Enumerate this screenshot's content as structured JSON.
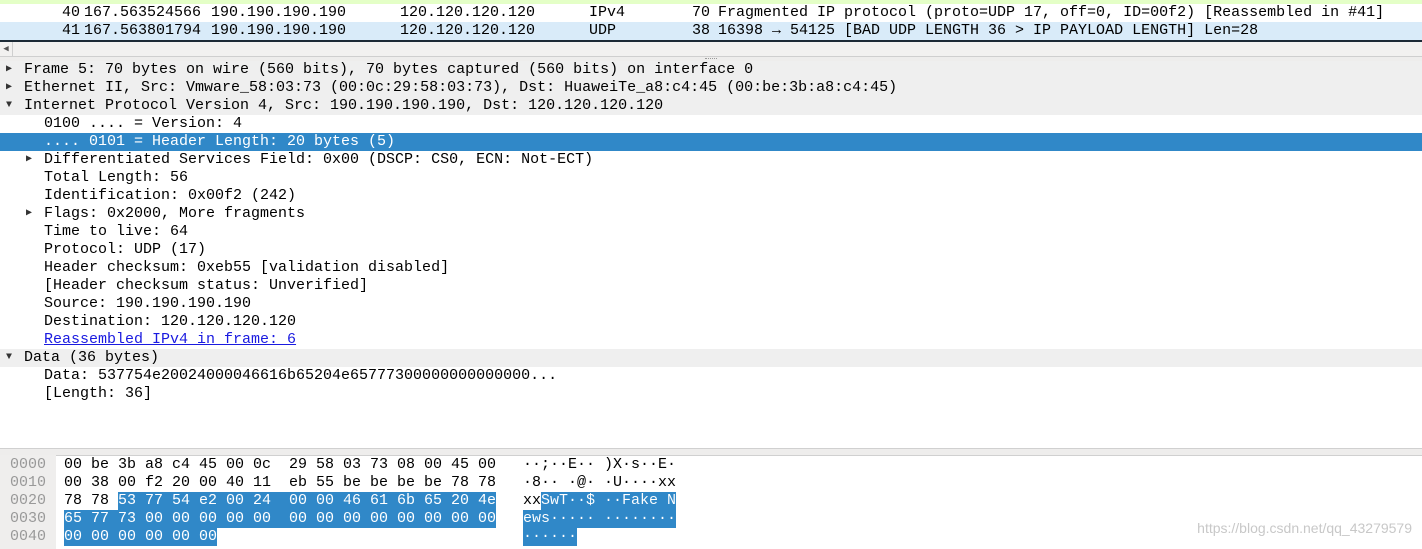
{
  "packet_list": {
    "rows": [
      {
        "no": "40",
        "time": "167.563524566",
        "source": "190.190.190.190",
        "destination": "120.120.120.120",
        "protocol": "IPv4",
        "length": "70",
        "info": "Fragmented IP protocol (proto=UDP 17, off=0, ID=00f2) [Reassembled in #41]"
      },
      {
        "no": "41",
        "time": "167.563801794",
        "source": "190.190.190.190",
        "destination": "120.120.120.120",
        "protocol": "UDP",
        "length": "38",
        "info": "16398 → 54125 [BAD UDP LENGTH 36 > IP PAYLOAD LENGTH] Len=28"
      }
    ],
    "row_colors": {
      "row40": "#ffffff",
      "row41": "#d9ebf9"
    }
  },
  "tree": {
    "rows": [
      {
        "level": 0,
        "expand": "collapsed",
        "text": "Frame 5: 70 bytes on wire (560 bits), 70 bytes captured (560 bits) on interface 0"
      },
      {
        "level": 0,
        "expand": "collapsed",
        "text": "Ethernet II, Src: Vmware_58:03:73 (00:0c:29:58:03:73), Dst: HuaweiTe_a8:c4:45 (00:be:3b:a8:c4:45)"
      },
      {
        "level": 0,
        "expand": "expanded",
        "text": "Internet Protocol Version 4, Src: 190.190.190.190, Dst: 120.120.120.120"
      },
      {
        "level": 1,
        "expand": "none",
        "text": "0100 .... = Version: 4"
      },
      {
        "level": 1,
        "expand": "none",
        "text": ".... 0101 = Header Length: 20 bytes (5)",
        "selected": true
      },
      {
        "level": 1,
        "expand": "collapsed",
        "text": "Differentiated Services Field: 0x00 (DSCP: CS0, ECN: Not-ECT)"
      },
      {
        "level": 1,
        "expand": "none",
        "text": "Total Length: 56"
      },
      {
        "level": 1,
        "expand": "none",
        "text": "Identification: 0x00f2 (242)"
      },
      {
        "level": 1,
        "expand": "collapsed",
        "text": "Flags: 0x2000, More fragments"
      },
      {
        "level": 1,
        "expand": "none",
        "text": "Time to live: 64"
      },
      {
        "level": 1,
        "expand": "none",
        "text": "Protocol: UDP (17)"
      },
      {
        "level": 1,
        "expand": "none",
        "text": "Header checksum: 0xeb55 [validation disabled]"
      },
      {
        "level": 1,
        "expand": "none",
        "text": "[Header checksum status: Unverified]"
      },
      {
        "level": 1,
        "expand": "none",
        "text": "Source: 190.190.190.190"
      },
      {
        "level": 1,
        "expand": "none",
        "text": "Destination: 120.120.120.120"
      },
      {
        "level": 1,
        "expand": "none",
        "text": "Reassembled IPv4 in frame: 6",
        "link": true
      },
      {
        "level": 0,
        "expand": "expanded",
        "text": "Data (36 bytes)"
      },
      {
        "level": 1,
        "expand": "none",
        "text": "Data: 537754e20024000046616b65204e65777300000000000000..."
      },
      {
        "level": 1,
        "expand": "none",
        "text": "[Length: 36]"
      }
    ]
  },
  "hex": {
    "highlight_from_byte": 34,
    "rows": [
      {
        "offset": "0000",
        "bytes": [
          "00",
          "be",
          "3b",
          "a8",
          "c4",
          "45",
          "00",
          "0c",
          "29",
          "58",
          "03",
          "73",
          "08",
          "00",
          "45",
          "00"
        ],
        "ascii": "··;··E·· )X·s··E·"
      },
      {
        "offset": "0010",
        "bytes": [
          "00",
          "38",
          "00",
          "f2",
          "20",
          "00",
          "40",
          "11",
          "eb",
          "55",
          "be",
          "be",
          "be",
          "be",
          "78",
          "78"
        ],
        "ascii": "·8·· ·@· ·U····xx"
      },
      {
        "offset": "0020",
        "bytes": [
          "78",
          "78",
          "53",
          "77",
          "54",
          "e2",
          "00",
          "24",
          "00",
          "00",
          "46",
          "61",
          "6b",
          "65",
          "20",
          "4e"
        ],
        "ascii": "xxSwT··$ ··Fake N"
      },
      {
        "offset": "0030",
        "bytes": [
          "65",
          "77",
          "73",
          "00",
          "00",
          "00",
          "00",
          "00",
          "00",
          "00",
          "00",
          "00",
          "00",
          "00",
          "00",
          "00"
        ],
        "ascii": "ews····· ········"
      },
      {
        "offset": "0040",
        "bytes": [
          "00",
          "00",
          "00",
          "00",
          "00",
          "00"
        ],
        "ascii": "······"
      }
    ]
  },
  "watermark": "https://blog.csdn.net/qq_43279579",
  "colors": {
    "selection": "#3088c8",
    "link": "#1a1ae0"
  }
}
